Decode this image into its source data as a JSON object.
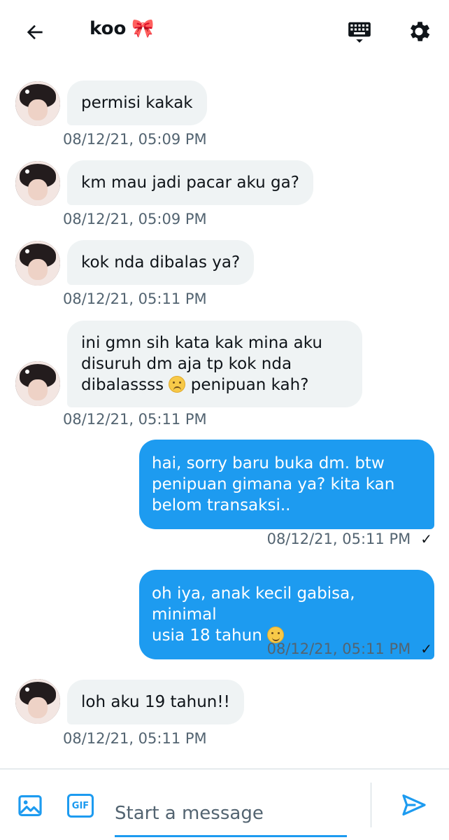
{
  "header": {
    "title": "koo",
    "title_emoji": "🎀",
    "icons": {
      "back": "arrow-left-icon",
      "keyboard": "keyboard-icon",
      "settings": "gear-icon"
    }
  },
  "messages": [
    {
      "direction": "in",
      "text": "permisi kakak",
      "timestamp": "08/12/21, 05:09 PM"
    },
    {
      "direction": "in",
      "text": "km mau jadi pacar aku ga?",
      "timestamp": "08/12/21, 05:09 PM"
    },
    {
      "direction": "in",
      "text": "kok nda dibalas ya?",
      "timestamp": "08/12/21, 05:11 PM"
    },
    {
      "direction": "in",
      "lines": [
        "ini gmn sih kata kak mina aku",
        "disuruh dm aja tp kok nda",
        "dibalassss",
        "penipuan kah?"
      ],
      "emoji": "persevering-face",
      "timestamp": "08/12/21, 05:11 PM"
    },
    {
      "direction": "out",
      "lines": [
        "hai, sorry baru buka dm. btw",
        "penipuan gimana ya? kita kan",
        "belom transaksi.."
      ],
      "timestamp": "08/12/21, 05:11 PM",
      "status": "✓"
    },
    {
      "direction": "out",
      "lines": [
        "oh iya, anak kecil gabisa, minimal",
        "usia 18 tahun"
      ],
      "emoji": "smiling-face",
      "timestamp": "08/12/21, 05:11 PM",
      "status": "✓"
    },
    {
      "direction": "in",
      "text": "loh aku 19 tahun!!",
      "timestamp": "08/12/21, 05:11 PM"
    }
  ],
  "composer": {
    "placeholder": "Start a message",
    "gif_label": "GIF",
    "icons": {
      "media": "image-icon",
      "gif": "gif-icon",
      "send": "send-icon"
    }
  },
  "colors": {
    "accent": "#1d9bf0",
    "incoming_bubble": "#eff3f4",
    "timestamp": "#536471"
  }
}
